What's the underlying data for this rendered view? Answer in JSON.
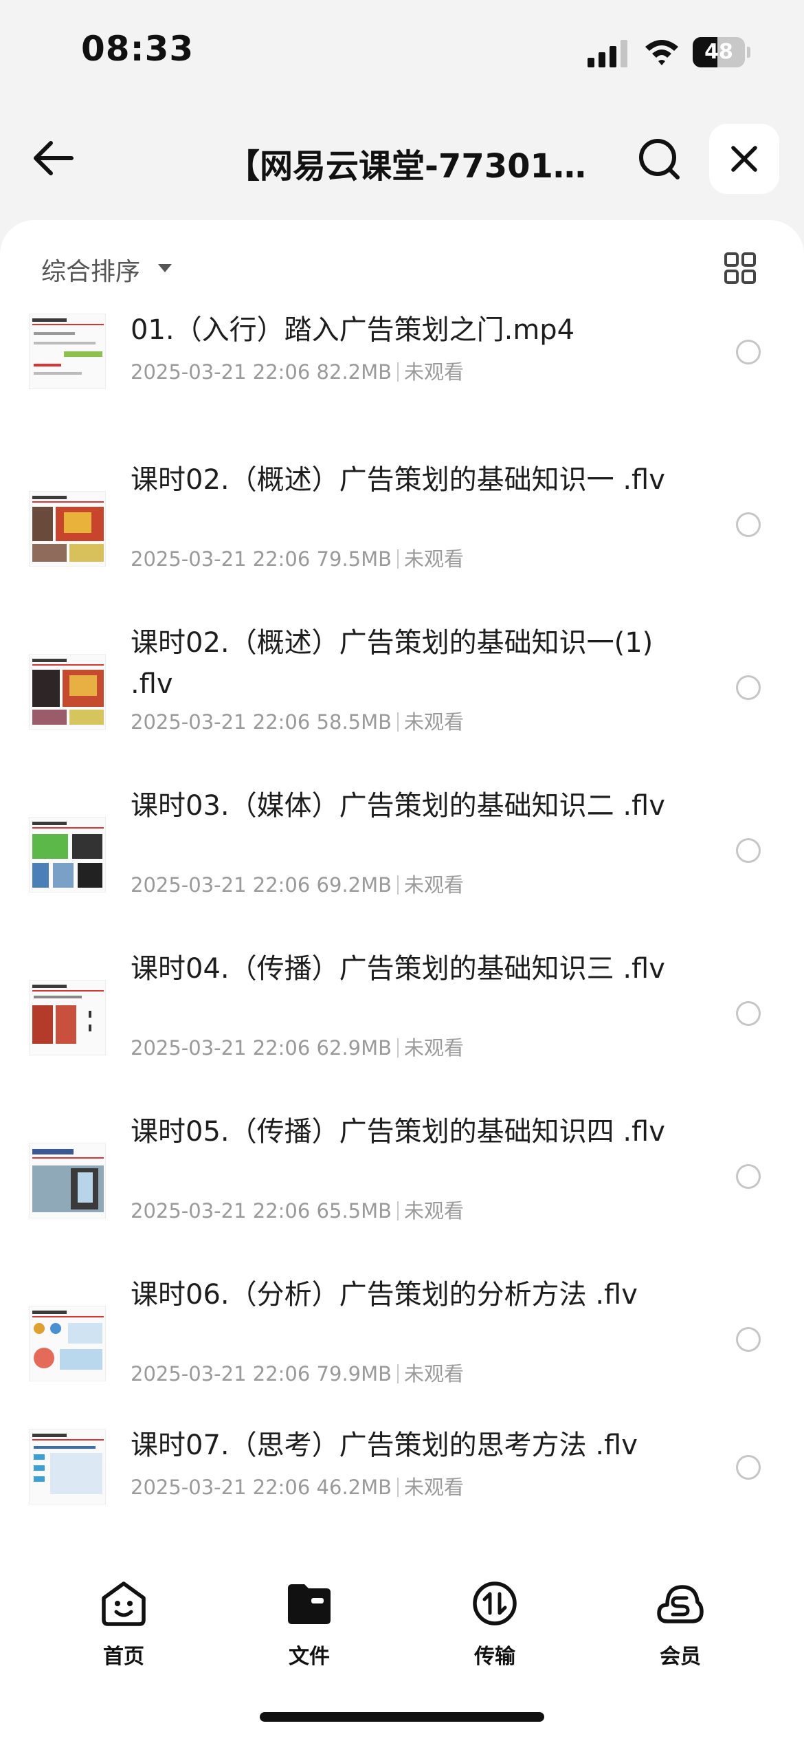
{
  "status_bar": {
    "time": "08:33",
    "battery_level": "48",
    "battery_fraction": 0.48
  },
  "nav": {
    "title": "【网易云课堂-773018..."
  },
  "sort": {
    "label": "综合排序"
  },
  "files": [
    {
      "name": "01.（入行）踏入广告策划之门.mp4",
      "date": "2025-03-21 22:06",
      "size": "82.2MB",
      "status": "未观看"
    },
    {
      "name": "课时02.（概述）广告策划的基础知识一 .flv",
      "date": "2025-03-21 22:06",
      "size": "79.5MB",
      "status": "未观看"
    },
    {
      "name": "课时02.（概述）广告策划的基础知识一(1) .flv",
      "date": "2025-03-21 22:06",
      "size": "58.5MB",
      "status": "未观看"
    },
    {
      "name": "课时03.（媒体）广告策划的基础知识二 .flv",
      "date": "2025-03-21 22:06",
      "size": "69.2MB",
      "status": "未观看"
    },
    {
      "name": "课时04.（传播）广告策划的基础知识三 .flv",
      "date": "2025-03-21 22:06",
      "size": "62.9MB",
      "status": "未观看"
    },
    {
      "name": "课时05.（传播）广告策划的基础知识四 .flv",
      "date": "2025-03-21 22:06",
      "size": "65.5MB",
      "status": "未观看"
    },
    {
      "name": "课时06.（分析）广告策划的分析方法 .flv",
      "date": "2025-03-21 22:06",
      "size": "79.9MB",
      "status": "未观看"
    },
    {
      "name": "课时07.（思考）广告策划的思考方法 .flv",
      "date": "2025-03-21 22:06",
      "size": "46.2MB",
      "status": "未观看"
    }
  ],
  "tabs": [
    {
      "label": "首页",
      "icon": "smile-face-icon"
    },
    {
      "label": "文件",
      "icon": "folder-icon"
    },
    {
      "label": "传输",
      "icon": "transfer-icon"
    },
    {
      "label": "会员",
      "icon": "vip-cloud-icon"
    }
  ]
}
